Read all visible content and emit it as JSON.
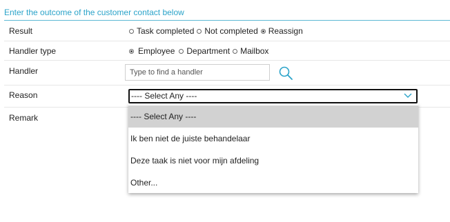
{
  "header": {
    "title": "Enter the outcome of the customer contact below"
  },
  "form": {
    "result": {
      "label": "Result",
      "options": [
        "Task completed",
        "Not completed",
        "Reassign"
      ],
      "selected": "Reassign"
    },
    "handler_type": {
      "label": "Handler type",
      "options": [
        "Employee",
        "Department",
        "Mailbox"
      ],
      "selected": "Employee"
    },
    "handler": {
      "label": "Handler",
      "placeholder": "Type to find a handler",
      "search_icon": "search-icon"
    },
    "reason": {
      "label": "Reason",
      "selected_value": "---- Select Any ----",
      "options": [
        "---- Select Any ----",
        "Ik ben niet de juiste behandelaar",
        "Deze taak is niet voor mijn afdeling",
        "Other..."
      ],
      "chevron_icon": "chevron-down-icon"
    },
    "remark": {
      "label": "Remark"
    }
  },
  "colors": {
    "accent": "#2aa3c9",
    "header_line": "#5bb8d4",
    "selected_option_bg": "#d2d2d2"
  }
}
